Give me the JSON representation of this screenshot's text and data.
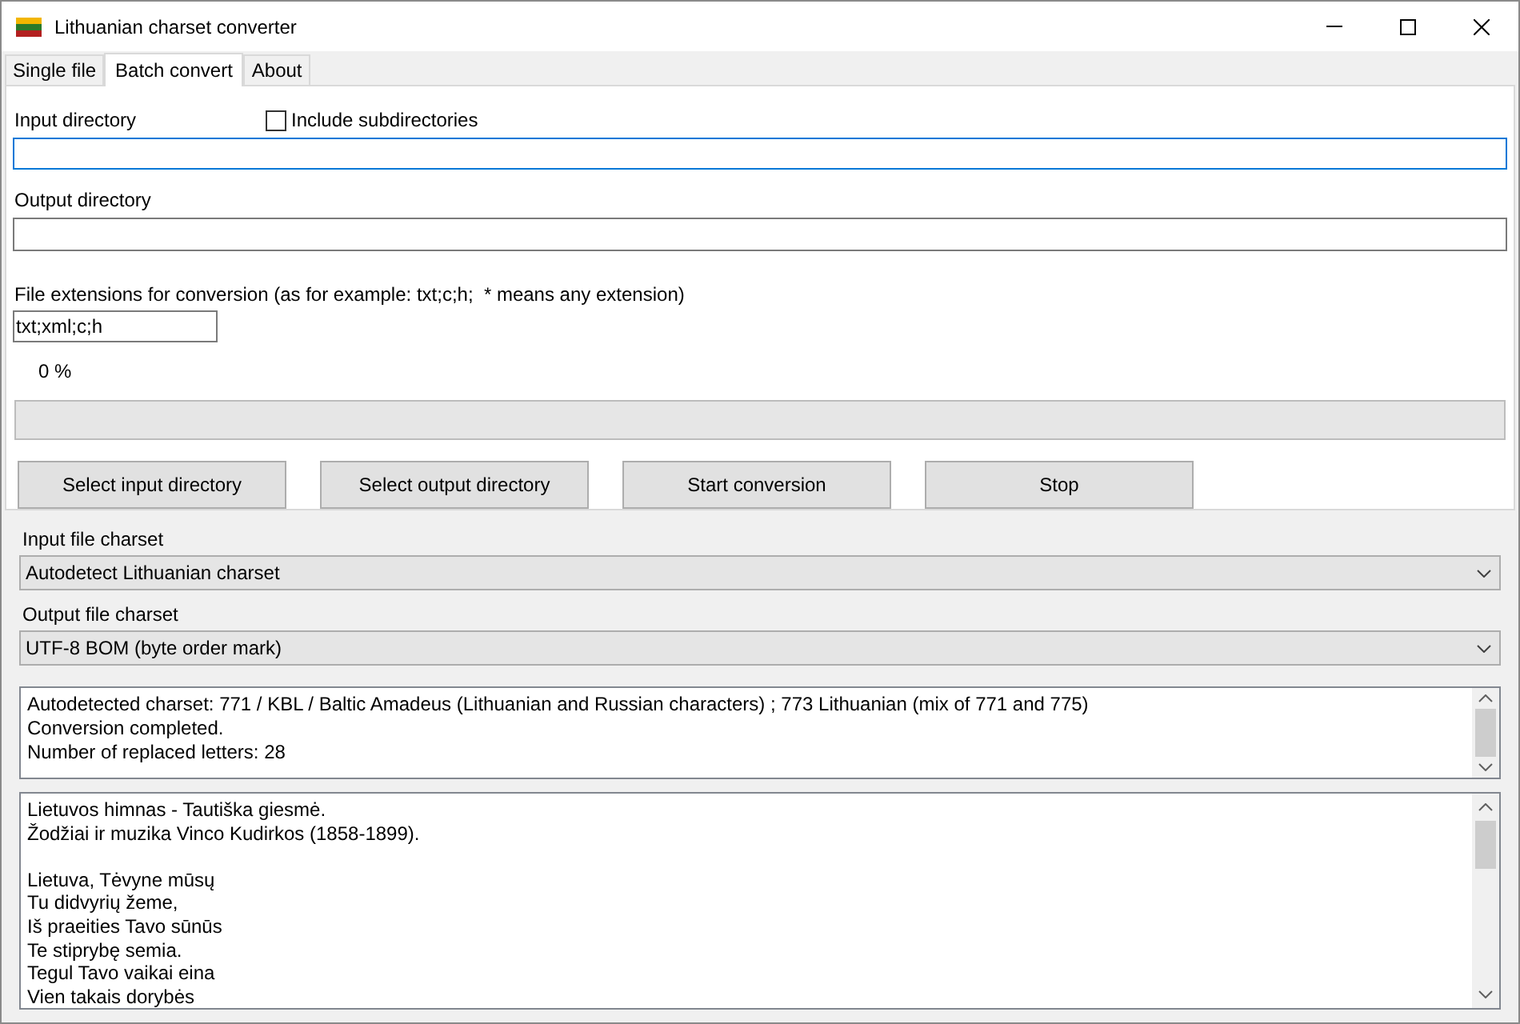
{
  "window": {
    "title": "Lithuanian charset converter"
  },
  "tabs": [
    {
      "label": "Single file",
      "selected": false
    },
    {
      "label": "Batch convert",
      "selected": true
    },
    {
      "label": "About",
      "selected": false
    }
  ],
  "input_directory": {
    "label": "Input directory"
  },
  "include_subdirectories": {
    "label": "Include subdirectories",
    "checked": false
  },
  "output_directory": {
    "label": "Output directory"
  },
  "extensions": {
    "label": "File extensions for conversion (as for example: txt;c;h;  * means any extension)",
    "value": "txt;xml;c;h"
  },
  "progress": {
    "reading": "0 %",
    "level": 0
  },
  "buttons": [
    "Select input directory",
    "Select output directory",
    "Start conversion",
    "Stop"
  ],
  "input_charset": {
    "label": "Input file charset",
    "value": "Autodetect Lithuanian charset"
  },
  "output_charset": {
    "label": "Output file charset",
    "value": "UTF-8 BOM (byte order mark)"
  },
  "log": [
    "Autodetected charset: 771 / KBL / Baltic Amadeus (Lithuanian and Russian characters) ; 773 Lithuanian (mix of 771 and 775)",
    "Conversion completed.",
    "Number of replaced letters: 28"
  ],
  "preview": [
    [
      "Lietuvos himnas - Tautiška giesmė.",
      "Žodžiai ir muzika Vinco Kudirkos (1858-1899)."
    ],
    [
      "Lietuva, Tėvyne mūsų",
      "Tu didvyrių žeme,",
      "Iš praeities Tavo sūnūs",
      "Te stiprybę semia.",
      "Tegul Tavo vaikai eina",
      "Vien takais dorybės"
    ]
  ]
}
